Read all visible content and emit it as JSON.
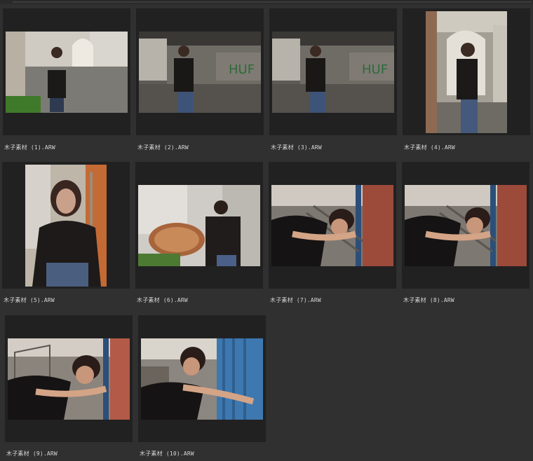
{
  "files": [
    {
      "name": "木子素材 (1).ARW"
    },
    {
      "name": "木子素材 (2).ARW"
    },
    {
      "name": "木子素材 (3).ARW"
    },
    {
      "name": "木子素材 (4).ARW"
    },
    {
      "name": "木子素材 (5).ARW"
    },
    {
      "name": "木子素材 (6).ARW"
    },
    {
      "name": "木子素材 (7).ARW"
    },
    {
      "name": "木子素材 (8).ARW"
    },
    {
      "name": "木子素材 (9).ARW"
    },
    {
      "name": "木子素材 (10).ARW"
    }
  ]
}
